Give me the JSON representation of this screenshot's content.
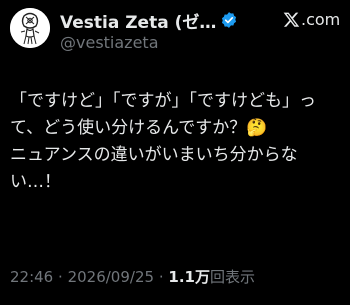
{
  "author": {
    "display_name": "Vestia Zeta (ゼ…",
    "handle": "@vestiazeta",
    "verified": true
  },
  "brand": {
    "icon": "x-logo-icon",
    "domain": ".com"
  },
  "tweet": {
    "text": "「ですけど」「ですが」「ですけども」って、どう使い分けるんですか？🤔\nニュアンスの違いがいまいち分からない…！"
  },
  "meta": {
    "time": "22:46",
    "separator": "·",
    "date": "2026/09/25",
    "views_count": "1.1万",
    "views_label": "回表示"
  },
  "colors": {
    "background": "#000000",
    "text": "#e7e9ea",
    "muted": "#71767b",
    "verified": "#1d9bf0"
  }
}
